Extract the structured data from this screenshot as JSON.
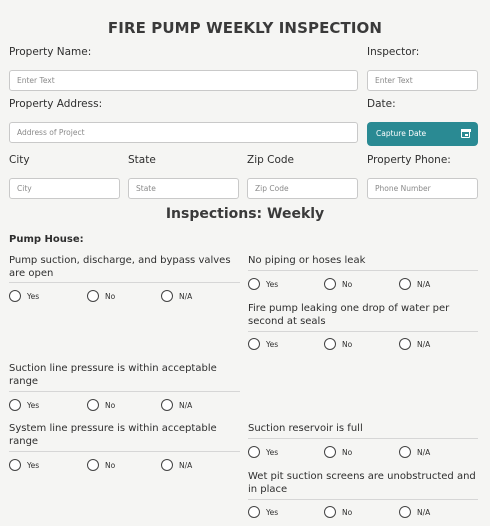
{
  "form": {
    "title": "FIRE PUMP WEEKLY INSPECTION",
    "property_name_label": "Property Name:",
    "property_name_placeholder": "Enter Text",
    "inspector_label": "Inspector:",
    "inspector_placeholder": "Enter Text",
    "property_address_label": "Property Address:",
    "property_address_placeholder": "Address of Project",
    "date_label": "Date:",
    "capture_date_label": "Capture Date",
    "city_label": "City",
    "city_placeholder": "City",
    "state_label": "State",
    "state_placeholder": "State",
    "zip_label": "Zip Code",
    "zip_placeholder": "Zip Code",
    "phone_label": "Property Phone:",
    "phone_placeholder": "Phone Number"
  },
  "inspections": {
    "title": "Inspections: Weekly",
    "section": "Pump House:",
    "options": [
      "Yes",
      "No",
      "N/A"
    ],
    "questions": {
      "q1": "Pump suction, discharge, and bypass valves are open",
      "q2": "No piping or hoses leak",
      "q3": "Fire pump leaking one drop of water per second at seals",
      "q4": "Suction line pressure is within acceptable range",
      "q5": "System line pressure is within acceptable range",
      "q6": "Suction reservoir is full",
      "q7": "Wet pit suction screens are unobstructed and in place"
    }
  },
  "colors": {
    "accent": "#2a8a93",
    "background": "#f5f5f3"
  },
  "icons": {
    "date_button": "calendar-icon"
  }
}
